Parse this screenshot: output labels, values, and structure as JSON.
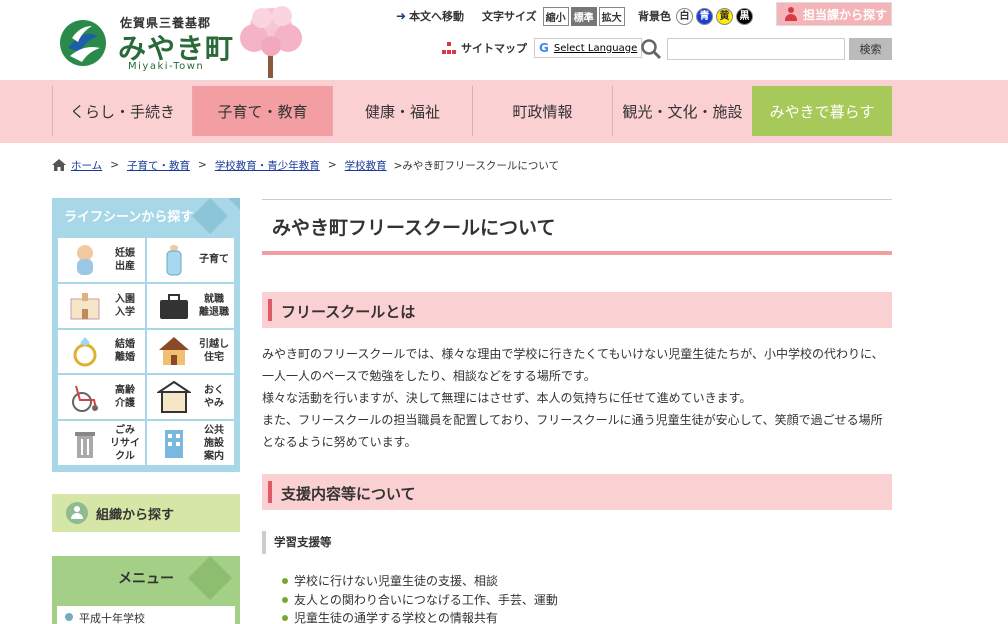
{
  "header": {
    "logo_pref": "佐賀県三養基郡",
    "logo_town": "みやき町",
    "logo_romaji": "Miyaki-Town",
    "skip_link": "本文へ移動",
    "fontsize_label": "文字サイズ",
    "fontsize_buttons": [
      "縮小",
      "標準",
      "拡大"
    ],
    "fontsize_selected": "標準",
    "bgcolor_label": "背景色",
    "bgcolor_buttons": [
      {
        "label": "白",
        "bg": "#ffffff",
        "fg": "#333333"
      },
      {
        "label": "青",
        "bg": "#1a3fd6",
        "fg": "#ffffff"
      },
      {
        "label": "黄",
        "bg": "#ffee00",
        "fg": "#333333"
      },
      {
        "label": "黒",
        "bg": "#000000",
        "fg": "#ffffff"
      }
    ],
    "tantou_button": "担当課から探す",
    "sitemap": "サイトマップ",
    "translate_g": "G",
    "translate_label": "Select Language",
    "search_placeholder": "",
    "search_button": "検索"
  },
  "gnav": {
    "items": [
      {
        "label": "くらし・手続き",
        "state": "normal"
      },
      {
        "label": "子育て・教育",
        "state": "active"
      },
      {
        "label": "健康・福祉",
        "state": "normal"
      },
      {
        "label": "町政情報",
        "state": "normal"
      },
      {
        "label": "観光・文化・施設",
        "state": "normal"
      },
      {
        "label": "みやきで暮らす",
        "state": "green"
      }
    ]
  },
  "breadcrumb": {
    "links": [
      "ホーム",
      "子育て・教育",
      "学校教育・青少年教育",
      "学校教育"
    ],
    "current": ">みやき町フリースクールについて"
  },
  "sidebar": {
    "lifescene_title": "ライフシーンから探す",
    "lifescene_items": [
      {
        "label": "妊娠\n出産",
        "icon": "baby-icon"
      },
      {
        "label": "子育て",
        "icon": "baby-bottle-icon"
      },
      {
        "label": "入園\n入学",
        "icon": "school-icon"
      },
      {
        "label": "就職\n離退職",
        "icon": "briefcase-icon"
      },
      {
        "label": "結婚\n離婚",
        "icon": "ring-icon"
      },
      {
        "label": "引越し\n住宅",
        "icon": "house-icon"
      },
      {
        "label": "高齢\n介護",
        "icon": "wheelchair-icon"
      },
      {
        "label": "おく\nやみ",
        "icon": "memorial-icon"
      },
      {
        "label": "ごみ\nリサイ\nクル",
        "icon": "trash-can-icon"
      },
      {
        "label": "公共\n施設\n案内",
        "icon": "building-icon"
      }
    ],
    "soshiki": "組織から探す",
    "menu_title": "メニュー",
    "menu_first": "平成十年学校"
  },
  "main": {
    "title": "みやき町フリースクールについて",
    "section1": "フリースクールとは",
    "paragraphs": [
      "みやき町のフリースクールでは、様々な理由で学校に行きたくてもいけない児童生徒たちが、小中学校の代わりに、",
      "一人一人のペースで勉強をしたり、相談などをする場所です。",
      "様々な活動を行いますが、決して無理にはさせず、本人の気持ちに任せて進めていきます。",
      "また、フリースクールの担当職員を配置しており、フリースクールに通う児童生徒が安心して、笑顔で過ごせる場所",
      "となるように努めています。"
    ],
    "section2": "支援内容等について",
    "subsection": "学習支援等",
    "bullets": [
      "学校に行けない児童生徒の支援、相談",
      "友人との関わり合いにつなげる工作、手芸、運動",
      "児童生徒の通学する学校との情報共有"
    ]
  },
  "colors": {
    "nav_bg": "#fbd0d2",
    "nav_active": "#f29ea2",
    "nav_green": "#a7c95a",
    "accent_red": "#e05a65",
    "sidebar_blue": "#a8d8e8",
    "sidebar_green": "#d6e6a6"
  }
}
